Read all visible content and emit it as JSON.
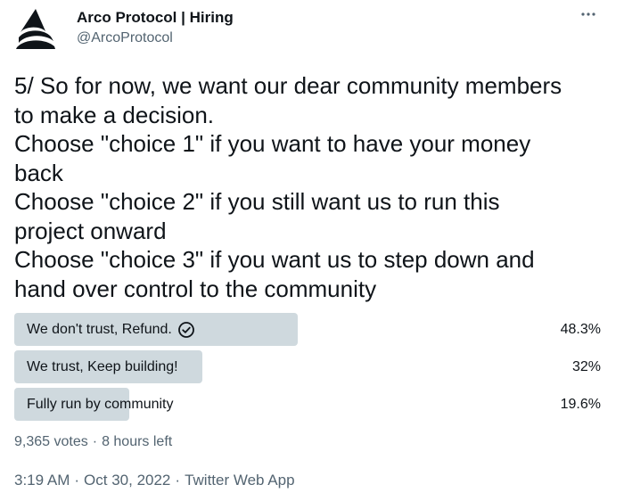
{
  "header": {
    "display_name": "Arco Protocol | Hiring",
    "handle": "@ArcoProtocol"
  },
  "tweet": {
    "lines": [
      "5/ So for now, we want our dear community members",
      "to make a decision.",
      "Choose \"choice 1\" if you want to have your money",
      "back",
      "Choose \"choice 2\" if you still want us to run this",
      "project onward",
      "Choose \"choice 3\" if you want us to step down and",
      "hand over control to the community"
    ]
  },
  "poll": {
    "options": [
      {
        "label": "We don't trust, Refund.",
        "percent_text": "48.3%",
        "percent": 48.3,
        "winner": true
      },
      {
        "label": "We trust, Keep building!",
        "percent_text": "32%",
        "percent": 32,
        "winner": false
      },
      {
        "label": "Fully run by community",
        "percent_text": "19.6%",
        "percent": 19.6,
        "winner": false
      }
    ],
    "votes": "9,365 votes",
    "time_left": "8 hours left"
  },
  "footer": {
    "time": "3:19 AM",
    "date": "Oct 30, 2022",
    "source": "Twitter Web App"
  },
  "colors": {
    "bar": "#cfd9de",
    "text": "#0f1419",
    "secondary": "#536471"
  },
  "icons": {
    "avatar": "arco-logo-icon",
    "more": "more-horizontal-icon",
    "winner": "check-circle-icon"
  }
}
